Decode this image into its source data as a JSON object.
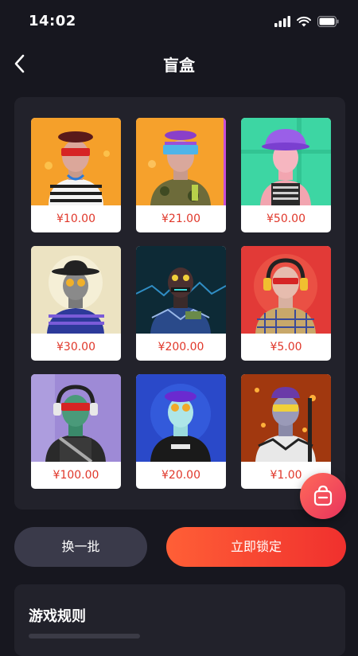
{
  "status_bar": {
    "time": "14:02",
    "icons": [
      "signal-icon",
      "wifi-icon",
      "battery-icon"
    ]
  },
  "nav": {
    "title": "盲盒",
    "back_icon": "chevron-left-icon"
  },
  "cards": [
    {
      "price": "¥10.00",
      "bg": "#f5a02a"
    },
    {
      "price": "¥21.00",
      "bg": "#f6a12c"
    },
    {
      "price": "¥50.00",
      "bg": "#3dd6a3"
    },
    {
      "price": "¥30.00",
      "bg": "#ece3c2"
    },
    {
      "price": "¥200.00",
      "bg": "#0d2a36"
    },
    {
      "price": "¥5.00",
      "bg": "#e23a37"
    },
    {
      "price": "¥100.00",
      "bg": "#9e8ad6"
    },
    {
      "price": "¥20.00",
      "bg": "#2a49c9"
    },
    {
      "price": "¥1.00",
      "bg": "#a1380f"
    }
  ],
  "floating_button": {
    "icon": "bag-icon"
  },
  "actions": {
    "refresh_label": "换一批",
    "lock_label": "立即锁定"
  },
  "rules": {
    "title": "游戏规则"
  },
  "colors": {
    "accent": "#f0302e",
    "price": "#e0372a",
    "background": "#17171f"
  }
}
